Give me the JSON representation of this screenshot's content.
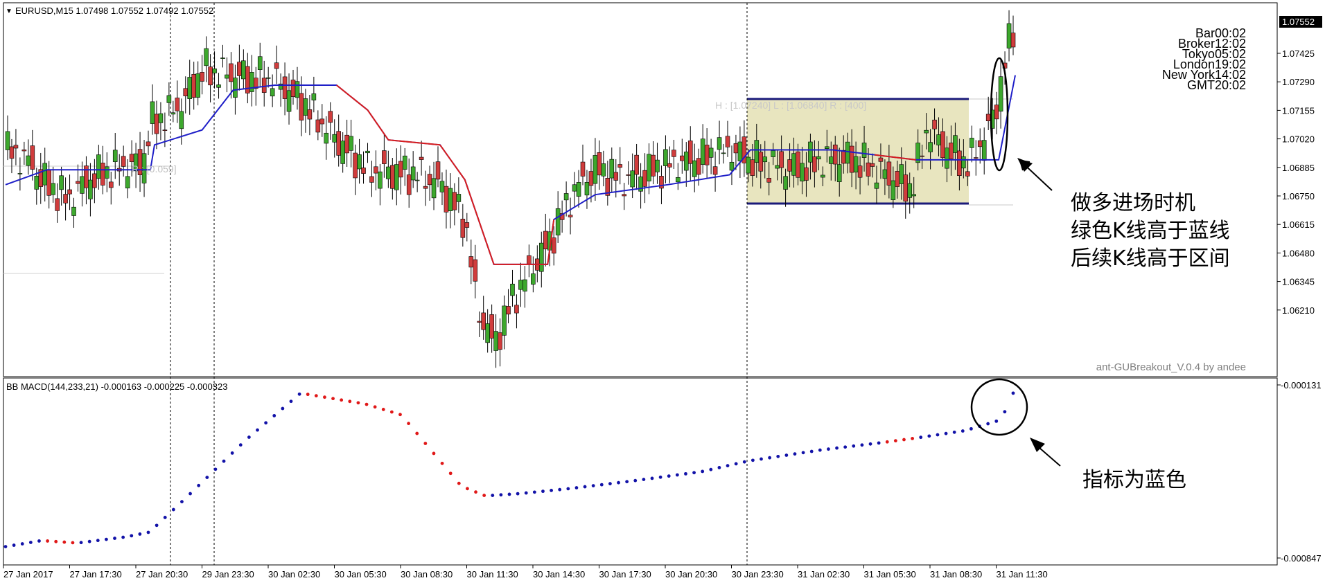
{
  "header": {
    "symbol_info": "EURUSD,M15  1.07498 1.07552 1.07492 1.07552",
    "current_price": "1.07552"
  },
  "price_axis": [
    "1.07425",
    "1.07290",
    "1.07155",
    "1.07020",
    "1.06885",
    "1.06750",
    "1.06615",
    "1.06480",
    "1.06345",
    "1.06210"
  ],
  "timers": [
    "Bar00:02",
    "Broker12:02",
    "Tokyo05:02",
    "London19:02",
    "New York14:02",
    "GMT20:02"
  ],
  "range_box": {
    "label": "H : [1.07240]     L : [1.06840]     R : [400]",
    "left_label": "R : [0.059]"
  },
  "signature": "ant-GUBreakout_V.0.4 by andee",
  "annotations": {
    "main": [
      "做多进场时机",
      "绿色K线高于蓝线",
      "后续K线高于区间"
    ],
    "indicator": "指标为蓝色"
  },
  "indicator": {
    "title": "BB MACD(144,233,21) -0.000163 -0.000225 -0.000323",
    "axis_top": "-0.000131",
    "axis_bottom": "-0.000847"
  },
  "time_axis": [
    "27 Jan 2017",
    "27 Jan 17:30",
    "27 Jan 20:30",
    "29 Jan 23:30",
    "30 Jan 02:30",
    "30 Jan 05:30",
    "30 Jan 08:30",
    "30 Jan 11:30",
    "30 Jan 14:30",
    "30 Jan 17:30",
    "30 Jan 20:30",
    "30 Jan 23:30",
    "31 Jan 02:30",
    "31 Jan 05:30",
    "31 Jan 08:30",
    "31 Jan 11:30"
  ],
  "colors": {
    "bull": "#3da82d",
    "bear": "#d03c3c",
    "line_blue": "#1f1fc8",
    "line_red": "#d81e1e",
    "box_fill": "#e8e5bf",
    "box_border": "#1a1a7a",
    "dot_blue": "#1212a8",
    "dot_red": "#e01818"
  },
  "chart_data": {
    "type": "candlestick",
    "price_range": [
      1.0614,
      1.0762
    ],
    "candles_ohlc_sampled": [
      [
        1.0702,
        1.0712,
        1.0696,
        1.0708
      ],
      [
        1.0706,
        1.0714,
        1.07,
        1.0704
      ],
      [
        1.07,
        1.0702,
        1.069,
        1.0692
      ],
      [
        1.0692,
        1.0694,
        1.068,
        1.0684
      ],
      [
        1.0684,
        1.0686,
        1.0676,
        1.068
      ],
      [
        1.0682,
        1.069,
        1.068,
        1.0688
      ],
      [
        1.0688,
        1.07,
        1.0686,
        1.0698
      ],
      [
        1.0708,
        1.0722,
        1.0706,
        1.072
      ],
      [
        1.0722,
        1.0736,
        1.072,
        1.0734
      ],
      [
        1.0734,
        1.0742,
        1.0728,
        1.0738
      ],
      [
        1.0738,
        1.074,
        1.073,
        1.0732
      ],
      [
        1.073,
        1.0732,
        1.0718,
        1.072
      ],
      [
        1.0718,
        1.072,
        1.0706,
        1.0708
      ],
      [
        1.0702,
        1.0704,
        1.0694,
        1.0696
      ],
      [
        1.0696,
        1.0698,
        1.069,
        1.0692
      ],
      [
        1.069,
        1.0692,
        1.067,
        1.0672
      ],
      [
        1.0672,
        1.0674,
        1.0636,
        1.0642
      ],
      [
        1.064,
        1.065,
        1.062,
        1.063
      ],
      [
        1.063,
        1.0652,
        1.0628,
        1.0648
      ],
      [
        1.0648,
        1.0672,
        1.0646,
        1.067
      ],
      [
        1.067,
        1.069,
        1.0668,
        1.0688
      ],
      [
        1.0688,
        1.071,
        1.0684,
        1.07
      ],
      [
        1.069,
        1.0698,
        1.0684,
        1.0696
      ],
      [
        1.0696,
        1.0702,
        1.069,
        1.0698
      ],
      [
        1.0698,
        1.0708,
        1.0694,
        1.0704
      ],
      [
        1.0704,
        1.0706,
        1.0694,
        1.0696
      ],
      [
        1.0696,
        1.0704,
        1.069,
        1.07
      ],
      [
        1.07,
        1.0708,
        1.0692,
        1.0696
      ],
      [
        1.0696,
        1.07,
        1.069,
        1.0694
      ],
      [
        1.0694,
        1.07,
        1.0688,
        1.0698
      ],
      [
        1.0698,
        1.072,
        1.0696,
        1.0716
      ],
      [
        1.0716,
        1.0718,
        1.0698,
        1.0702
      ],
      [
        1.0702,
        1.074,
        1.07,
        1.0748
      ],
      [
        1.0748,
        1.0756,
        1.0744,
        1.0755
      ]
    ],
    "supertrend_blue": "step line below price, colored red when above price",
    "range_high": 1.0724,
    "range_low": 1.0684,
    "indicator_type": "dots (BB MACD)",
    "indicator_range": [
      -0.000847,
      -0.000131
    ]
  }
}
